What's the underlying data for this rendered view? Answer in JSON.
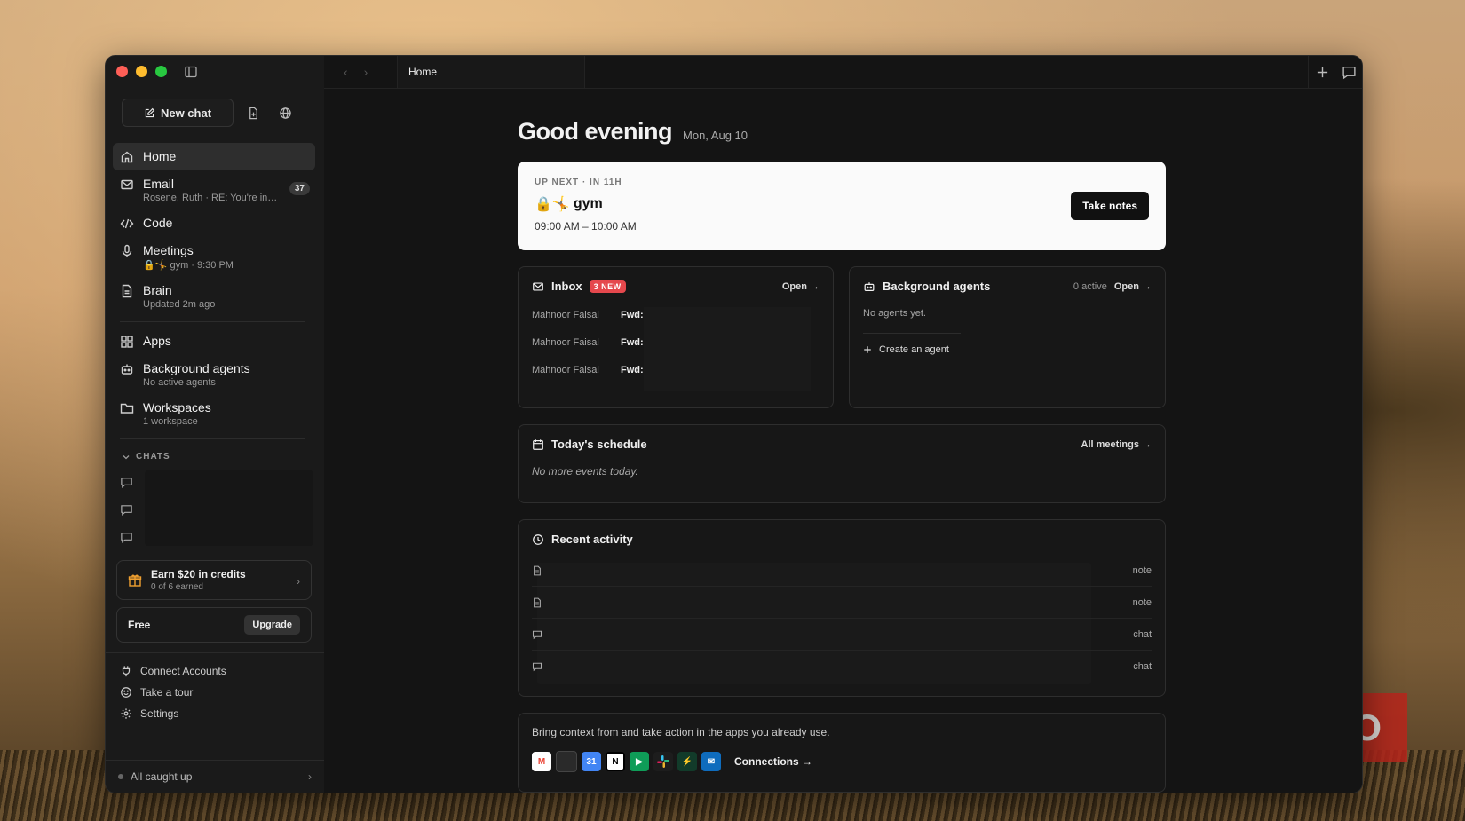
{
  "sidebar": {
    "new_chat_label": "New chat",
    "items": [
      {
        "label": "Home",
        "sub": ""
      },
      {
        "label": "Email",
        "sub": "Rosene, Ruth · RE: You're invi...",
        "badge": "37"
      },
      {
        "label": "Code",
        "sub": ""
      },
      {
        "label": "Meetings",
        "sub": "🔒🤸 gym · 9:30 PM"
      },
      {
        "label": "Brain",
        "sub": "Updated 2m ago"
      },
      {
        "label": "Apps",
        "sub": ""
      },
      {
        "label": "Background agents",
        "sub": "No active agents"
      },
      {
        "label": "Workspaces",
        "sub": "1 workspace"
      }
    ],
    "chats_header": "CHATS",
    "promo": {
      "title": "Earn $20 in credits",
      "sub": "0 of 6 earned"
    },
    "plan": {
      "label": "Free",
      "upgrade": "Upgrade"
    },
    "footer": [
      {
        "label": "Connect Accounts"
      },
      {
        "label": "Take a tour"
      },
      {
        "label": "Settings"
      }
    ],
    "status": "All caught up"
  },
  "tab": {
    "label": "Home"
  },
  "main": {
    "greeting": "Good evening",
    "date": "Mon, Aug 10",
    "upnext": {
      "kicker": "UP NEXT · IN 11H",
      "emoji": "🔒🤸",
      "title": "gym",
      "time": "09:00 AM – 10:00 AM",
      "button": "Take notes"
    },
    "inbox": {
      "title": "Inbox",
      "badge": "3 NEW",
      "open": "Open →",
      "rows": [
        {
          "from": "Mahnoor Faisal",
          "subject": "Fwd: |"
        },
        {
          "from": "Mahnoor Faisal",
          "subject": "Fwd: /"
        },
        {
          "from": "Mahnoor Faisal",
          "subject": "Fwd: |"
        }
      ]
    },
    "agents": {
      "title": "Background agents",
      "active": "0 active",
      "open": "Open →",
      "empty": "No agents yet.",
      "create": "Create an agent"
    },
    "schedule": {
      "title": "Today's schedule",
      "link": "All meetings →",
      "empty": "No more events today."
    },
    "recent": {
      "title": "Recent activity",
      "rows": [
        {
          "kind": "note"
        },
        {
          "kind": "note"
        },
        {
          "kind": "chat"
        },
        {
          "kind": "chat"
        }
      ]
    },
    "connect": {
      "text": "Bring context from and take action in the apps you already use.",
      "link": "Connections →",
      "calendar_day": "31"
    }
  },
  "watermark": "MUO"
}
